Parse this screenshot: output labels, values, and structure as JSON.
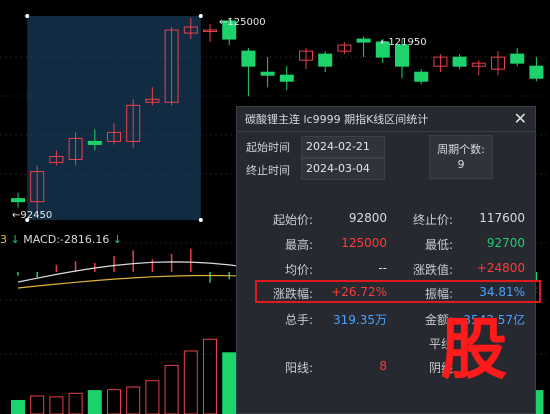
{
  "chart_data": {
    "type": "candlestick",
    "price_markers": {
      "high": "125000",
      "mid_high": "121950",
      "low": "92450"
    },
    "candles": [
      {
        "o": 95000,
        "c": 94500,
        "h": 96000,
        "l": 93500
      },
      {
        "o": 94500,
        "c": 99500,
        "h": 100500,
        "l": 92450
      },
      {
        "o": 101000,
        "c": 102000,
        "h": 103000,
        "l": 100500
      },
      {
        "o": 101500,
        "c": 105000,
        "h": 106000,
        "l": 100500
      },
      {
        "o": 104500,
        "c": 104000,
        "h": 106500,
        "l": 103000
      },
      {
        "o": 104500,
        "c": 106000,
        "h": 107500,
        "l": 104000
      },
      {
        "o": 104500,
        "c": 110500,
        "h": 111500,
        "l": 103500
      },
      {
        "o": 111000,
        "c": 111500,
        "h": 113500,
        "l": 110500
      },
      {
        "o": 111000,
        "c": 123000,
        "h": 123500,
        "l": 110500
      },
      {
        "o": 122500,
        "c": 123500,
        "h": 125000,
        "l": 121500
      },
      {
        "o": 123000,
        "c": 123000,
        "h": 124000,
        "l": 121000
      },
      {
        "o": 124500,
        "c": 121500,
        "h": 125000,
        "l": 120500
      },
      {
        "o": 119500,
        "c": 117000,
        "h": 120000,
        "l": 112000
      },
      {
        "o": 116000,
        "c": 115500,
        "h": 118500,
        "l": 113500
      },
      {
        "o": 115500,
        "c": 114500,
        "h": 117000,
        "l": 113000
      },
      {
        "o": 118000,
        "c": 119500,
        "h": 120000,
        "l": 116500
      },
      {
        "o": 119000,
        "c": 117000,
        "h": 119500,
        "l": 116000
      },
      {
        "o": 119500,
        "c": 120500,
        "h": 121000,
        "l": 119000
      },
      {
        "o": 121500,
        "c": 121000,
        "h": 121950,
        "l": 118500
      },
      {
        "o": 121000,
        "c": 118500,
        "h": 121500,
        "l": 117500
      },
      {
        "o": 120500,
        "c": 117000,
        "h": 121500,
        "l": 115000
      },
      {
        "o": 116000,
        "c": 114500,
        "h": 116500,
        "l": 114000
      },
      {
        "o": 117000,
        "c": 118500,
        "h": 119000,
        "l": 116000
      },
      {
        "o": 118500,
        "c": 117000,
        "h": 119000,
        "l": 116500
      },
      {
        "o": 117000,
        "c": 117500,
        "h": 118000,
        "l": 115500
      },
      {
        "o": 116500,
        "c": 118500,
        "h": 119500,
        "l": 115500
      },
      {
        "o": 119000,
        "c": 117500,
        "h": 120000,
        "l": 117000
      },
      {
        "o": 117000,
        "c": 115000,
        "h": 118500,
        "l": 114500
      }
    ],
    "selection": {
      "from_index": 1,
      "to_index": 9
    },
    "macd_histogram": [
      -0.2,
      -0.3,
      0.4,
      0.6,
      0.5,
      0.9,
      1.2,
      0.7,
      1.0,
      1.3,
      -0.6,
      -0.4,
      -0.3,
      -0.2,
      0.3,
      -0.5,
      0.2,
      -0.3,
      -0.4,
      -0.6,
      -0.2,
      -0.4,
      0.3,
      -0.2,
      -0.3,
      0.2,
      -0.4,
      -0.5
    ],
    "volume": [
      1.5,
      2.0,
      1.9,
      2.3,
      2.6,
      2.7,
      3.0,
      3.7,
      5.4,
      7.0,
      8.3,
      6.8,
      6.0,
      4.2,
      3.1,
      4.0,
      3.0,
      3.4,
      2.5,
      3.8,
      5.6,
      4.6,
      3.2,
      2.4,
      3.0,
      3.5,
      2.9,
      2.6
    ],
    "colors": {
      "up": "#e8414b",
      "down": "#1dd36b",
      "selection": "#1f4f78",
      "dif": "#d9dde2",
      "dea": "#e0b03a"
    }
  },
  "macd": {
    "label_prefix": "3",
    "text": "MACD:-2816.16"
  },
  "panel": {
    "title": "碳酸锂主连   lc9999   期指K线区间统计",
    "close": "✕",
    "start_label": "起始时间",
    "start_value": "2024-02-21",
    "end_label": "终止时间",
    "end_value": "2024-03-04",
    "period_label": "周期个数:",
    "period_value": "9",
    "rows": {
      "start_price_label": "起始价:",
      "start_price": "92800",
      "end_price_label": "终止价:",
      "end_price": "117600",
      "high_label": "最高:",
      "high": "125000",
      "low_label": "最低:",
      "low": "92700",
      "avg_label": "均价:",
      "avg": "--",
      "change_label": "涨跌值:",
      "change": "+24800",
      "pct_label": "涨跌幅:",
      "pct": "+26.72%",
      "amp_label": "振幅:",
      "amp": "34.81%",
      "turnover_label": "总手:",
      "turnover": "319.35万",
      "amount_label": "金额:",
      "amount": "3543.57亿",
      "flat_label": "平线",
      "up_label": "阳线:",
      "up_count": "8",
      "down_label": "阴线"
    }
  },
  "watermark": "股"
}
